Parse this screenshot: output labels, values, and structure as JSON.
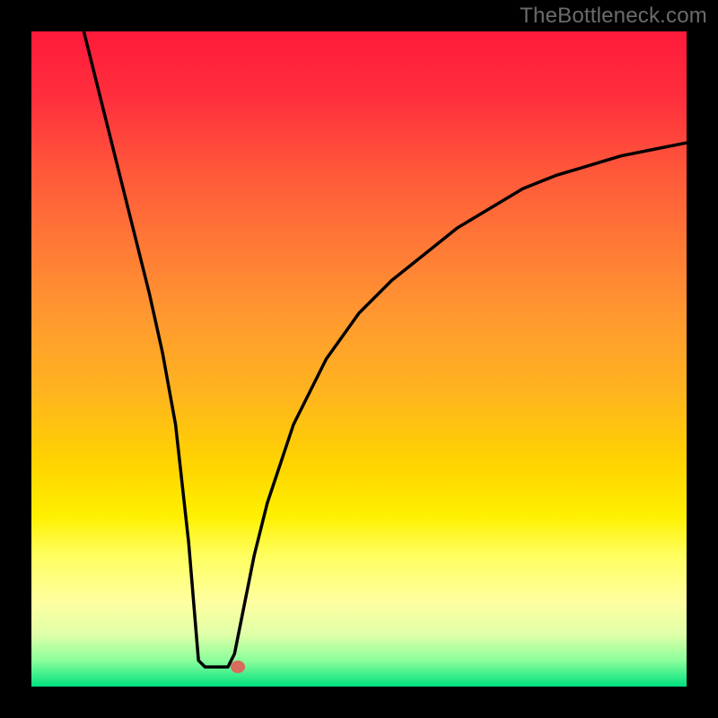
{
  "watermark": "TheBottleneck.com",
  "colors": {
    "background": "#000000",
    "curve": "#000000",
    "marker": "#d86b5b"
  },
  "chart_data": {
    "type": "line",
    "title": "",
    "xlabel": "",
    "ylabel": "",
    "xlim": [
      0,
      100
    ],
    "ylim": [
      0,
      100
    ],
    "grid": false,
    "series": [
      {
        "name": "curve",
        "x": [
          8,
          10,
          12,
          14,
          16,
          18,
          20,
          22,
          24,
          25.5,
          26.5,
          28.5,
          30,
          31,
          32,
          34,
          36,
          40,
          45,
          50,
          55,
          60,
          65,
          70,
          75,
          80,
          85,
          90,
          95,
          100
        ],
        "values": [
          100,
          92,
          84,
          76,
          68,
          60,
          51,
          40,
          22,
          4,
          3,
          3,
          3,
          5,
          10,
          20,
          28,
          40,
          50,
          57,
          62,
          66,
          70,
          73,
          76,
          78,
          79.5,
          81,
          82,
          83
        ]
      }
    ],
    "marker": {
      "x": 31.5,
      "y": 3
    },
    "gradient_stops": [
      {
        "pos": 0,
        "color": "#ff1a3a"
      },
      {
        "pos": 22,
        "color": "#ff5a3a"
      },
      {
        "pos": 55,
        "color": "#ffb41f"
      },
      {
        "pos": 74,
        "color": "#fff000"
      },
      {
        "pos": 92,
        "color": "#e0ffa8"
      },
      {
        "pos": 100,
        "color": "#00e080"
      }
    ]
  }
}
